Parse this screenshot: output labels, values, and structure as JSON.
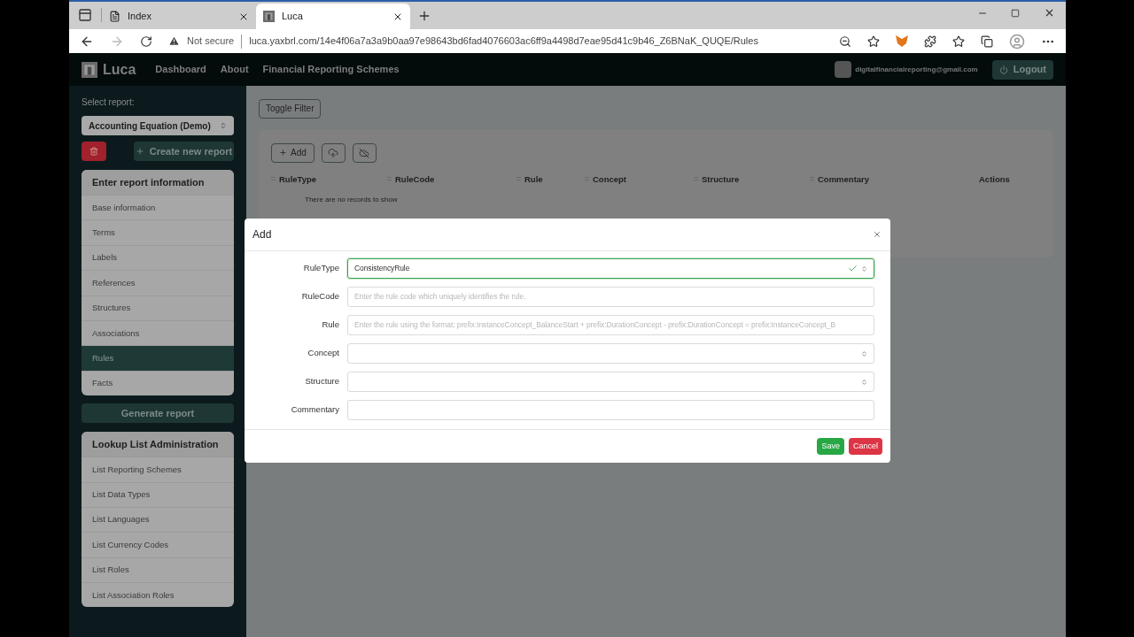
{
  "browser": {
    "tabs": [
      {
        "title": "Index",
        "selected": false
      },
      {
        "title": "Luca",
        "selected": true
      }
    ],
    "security": "Not secure",
    "url": "luca.yaxbrl.com/14e4f06a7a3a9b0aa97e98643bd6fad4076603ac6ff9a4498d7eae95d41c9b46_Z6BNaK_QUQE/Rules"
  },
  "navbar": {
    "brand": "Luca",
    "links": [
      "Dashboard",
      "About",
      "Financial Reporting Schemes"
    ],
    "user_email": "digitalfinancialreporting@gmail.com",
    "logout": "Logout"
  },
  "sidebar": {
    "select_label": "Select report:",
    "report": "Accounting Equation (Demo)",
    "create_button": "Create new report",
    "sections": [
      {
        "title": "Enter report information",
        "items": [
          {
            "label": "Base information",
            "selected": false
          },
          {
            "label": "Terms",
            "selected": false
          },
          {
            "label": "Labels",
            "selected": false
          },
          {
            "label": "References",
            "selected": false
          },
          {
            "label": "Structures",
            "selected": false
          },
          {
            "label": "Associations",
            "selected": false
          },
          {
            "label": "Rules",
            "selected": true
          },
          {
            "label": "Facts",
            "selected": false
          }
        ]
      },
      {
        "title": "Lookup List Administration",
        "items": [
          {
            "label": "List Reporting Schemes",
            "selected": false
          },
          {
            "label": "List Data Types",
            "selected": false
          },
          {
            "label": "List Languages",
            "selected": false
          },
          {
            "label": "List Currency Codes",
            "selected": false
          },
          {
            "label": "List Roles",
            "selected": false
          },
          {
            "label": "List Association Roles",
            "selected": false
          }
        ]
      }
    ],
    "generate_button": "Generate report"
  },
  "main": {
    "toggle_filter": "Toggle Filter",
    "add_button": "Add",
    "columns": [
      {
        "label": "RuleType",
        "sortable": true
      },
      {
        "label": "RuleCode",
        "sortable": true
      },
      {
        "label": "Rule",
        "sortable": true
      },
      {
        "label": "Concept",
        "sortable": true
      },
      {
        "label": "Structure",
        "sortable": true
      },
      {
        "label": "Commentary",
        "sortable": true
      },
      {
        "label": "Actions",
        "sortable": false
      }
    ],
    "empty_message": "There are no records to show"
  },
  "modal": {
    "title": "Add",
    "fields": [
      {
        "label": "RuleType",
        "kind": "select",
        "value": "ConsistencyRule",
        "valid": true
      },
      {
        "label": "RuleCode",
        "kind": "input",
        "placeholder": "Enter the rule code which uniquely identifies the rule.",
        "valid": false
      },
      {
        "label": "Rule",
        "kind": "input",
        "placeholder": "Enter the rule using the format: prefix:InstanceConcept_BalanceStart + prefix:DurationConcept - prefix:DurationConcept = prefix:InstanceConcept_B",
        "valid": false
      },
      {
        "label": "Concept",
        "kind": "select",
        "valid": false
      },
      {
        "label": "Structure",
        "kind": "select",
        "valid": false
      },
      {
        "label": "Commentary",
        "kind": "input",
        "valid": false
      }
    ],
    "buttons": [
      {
        "label": "Save",
        "kind": "primary"
      },
      {
        "label": "Cancel",
        "kind": "danger"
      }
    ]
  }
}
